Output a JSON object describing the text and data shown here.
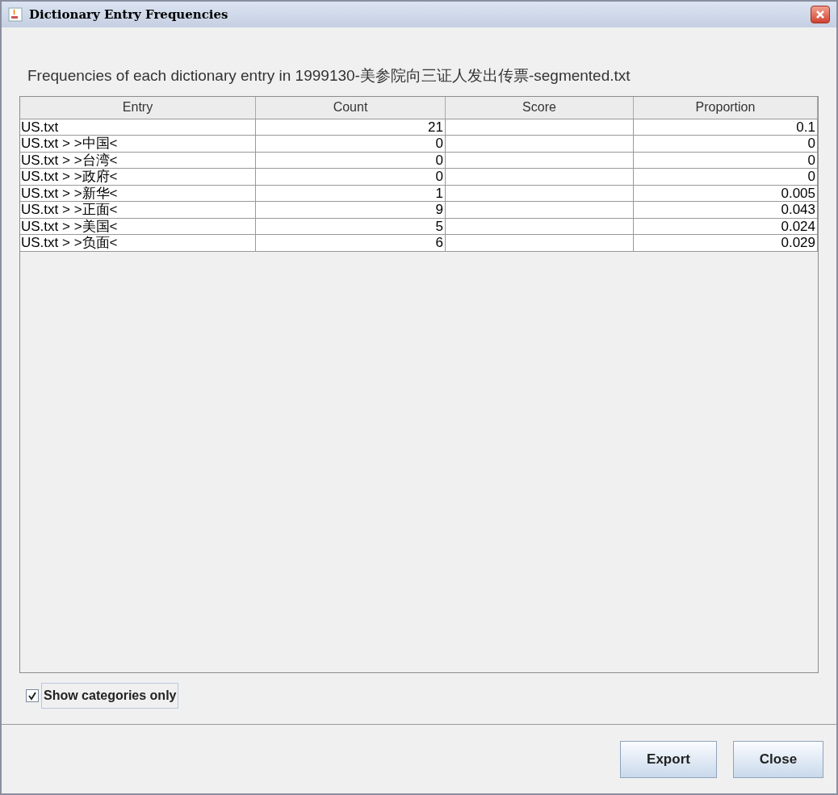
{
  "window": {
    "title": "Dictionary Entry Frequencies"
  },
  "caption": "Frequencies of each dictionary entry in 1999130-美参院向三证人发出传票-segmented.txt",
  "table": {
    "columns": [
      "Entry",
      "Count",
      "Score",
      "Proportion"
    ],
    "rows": [
      {
        "entry": "US.txt",
        "count": "21",
        "proportion": "0.1"
      },
      {
        "entry": "US.txt > >中国<",
        "count": "0",
        "proportion": "0"
      },
      {
        "entry": "US.txt > >台湾<",
        "count": "0",
        "proportion": "0"
      },
      {
        "entry": "US.txt > >政府<",
        "count": "0",
        "proportion": "0"
      },
      {
        "entry": "US.txt > >新华<",
        "count": "1",
        "proportion": "0.005"
      },
      {
        "entry": "US.txt > >正面<",
        "count": "9",
        "proportion": "0.043"
      },
      {
        "entry": "US.txt > >美国<",
        "count": "5",
        "proportion": "0.024"
      },
      {
        "entry": "US.txt > >负面<",
        "count": "6",
        "proportion": "0.029"
      }
    ]
  },
  "checkbox": {
    "label": "Show categories only",
    "checked": true
  },
  "buttons": [
    "Export",
    "Close"
  ]
}
